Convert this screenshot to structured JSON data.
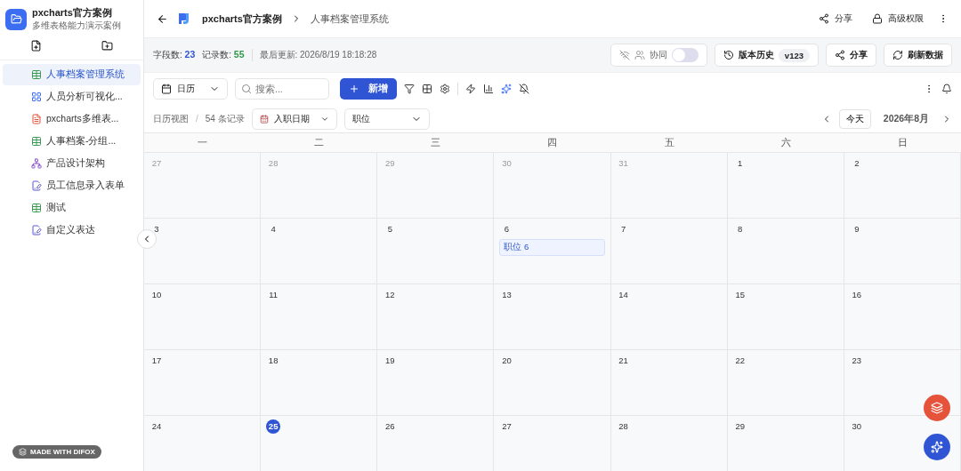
{
  "app": {
    "title": "pxcharts官方案例",
    "subtitle": "多维表格能力演示案例"
  },
  "sidebar": {
    "items": [
      {
        "label": "人事档案管理系统",
        "kind": "table",
        "selected": true
      },
      {
        "label": "人员分析可视化...",
        "kind": "dashboard",
        "selected": false
      },
      {
        "label": "pxcharts多维表...",
        "kind": "doc",
        "selected": false
      },
      {
        "label": "人事档案-分组...",
        "kind": "table",
        "selected": false
      },
      {
        "label": "产品设计架构",
        "kind": "org",
        "selected": false
      },
      {
        "label": "员工信息录入表单",
        "kind": "form",
        "selected": false
      },
      {
        "label": "测试",
        "kind": "table",
        "selected": false
      },
      {
        "label": "自定义表达",
        "kind": "form",
        "selected": false
      }
    ],
    "badge": "MADE WITH DIFOX"
  },
  "header": {
    "breadcrumb": [
      "pxcharts官方案例",
      "人事档案管理系统"
    ],
    "share": "分享",
    "permissions": "高级权限"
  },
  "stats": {
    "fields_label": "字段数:",
    "fields": "23",
    "records_label": "记录数:",
    "records": "55",
    "updated": "最后更新: 2026/8/19 18:18:28",
    "collab": {
      "label": "协同",
      "on": false
    },
    "history": "版本历史",
    "version": "v123",
    "share": "分享",
    "refresh": "刷新数据"
  },
  "toolbar": {
    "view": "日历",
    "search_placeholder": "搜索...",
    "add": "新增"
  },
  "subbar": {
    "view_name": "日历视图",
    "separator": "/",
    "count": "54 条记录",
    "date_field": "入职日期",
    "group_field": "职位",
    "today": "今天",
    "month": "2026年8月"
  },
  "calendar": {
    "weekdays": [
      "一",
      "二",
      "三",
      "四",
      "五",
      "六",
      "日"
    ],
    "days": [
      {
        "day": "27",
        "muted": true,
        "today": false
      },
      {
        "day": "28",
        "muted": true,
        "today": false
      },
      {
        "day": "29",
        "muted": true,
        "today": false
      },
      {
        "day": "30",
        "muted": true,
        "today": false
      },
      {
        "day": "31",
        "muted": true,
        "today": false
      },
      {
        "day": "1",
        "muted": false,
        "today": false
      },
      {
        "day": "2",
        "muted": false,
        "today": false
      },
      {
        "day": "3",
        "muted": false,
        "today": false
      },
      {
        "day": "4",
        "muted": false,
        "today": false
      },
      {
        "day": "5",
        "muted": false,
        "today": false
      },
      {
        "day": "6",
        "muted": false,
        "today": false,
        "events": [
          "职位 6"
        ]
      },
      {
        "day": "7",
        "muted": false,
        "today": false
      },
      {
        "day": "8",
        "muted": false,
        "today": false
      },
      {
        "day": "9",
        "muted": false,
        "today": false
      },
      {
        "day": "10",
        "muted": false,
        "today": false
      },
      {
        "day": "11",
        "muted": false,
        "today": false
      },
      {
        "day": "12",
        "muted": false,
        "today": false
      },
      {
        "day": "13",
        "muted": false,
        "today": false
      },
      {
        "day": "14",
        "muted": false,
        "today": false
      },
      {
        "day": "15",
        "muted": false,
        "today": false
      },
      {
        "day": "16",
        "muted": false,
        "today": false
      },
      {
        "day": "17",
        "muted": false,
        "today": false
      },
      {
        "day": "18",
        "muted": false,
        "today": false
      },
      {
        "day": "19",
        "muted": false,
        "today": false
      },
      {
        "day": "20",
        "muted": false,
        "today": false
      },
      {
        "day": "21",
        "muted": false,
        "today": false
      },
      {
        "day": "22",
        "muted": false,
        "today": false
      },
      {
        "day": "23",
        "muted": false,
        "today": false
      },
      {
        "day": "24",
        "muted": false,
        "today": false
      },
      {
        "day": "25",
        "muted": false,
        "today": true
      },
      {
        "day": "26",
        "muted": false,
        "today": false
      },
      {
        "day": "27",
        "muted": false,
        "today": false
      },
      {
        "day": "28",
        "muted": false,
        "today": false
      },
      {
        "day": "29",
        "muted": false,
        "today": false
      },
      {
        "day": "30",
        "muted": false,
        "today": false
      }
    ]
  }
}
